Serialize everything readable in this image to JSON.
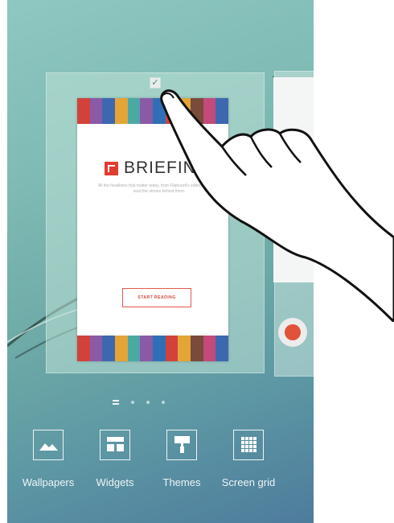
{
  "widget": {
    "brand": "BRIEFING",
    "description": "All the headlines that matter today, from Flipboard's editors. Swipe to read the stories behind them.",
    "button_label": "START READING",
    "stripe_colors": [
      "#d2423b",
      "#8a5aa6",
      "#3d68b0",
      "#e4a436",
      "#4aa9a5",
      "#8a5aa6",
      "#2f6fb7",
      "#d2423b",
      "#e4a436",
      "#7a4a3a",
      "#c34a7a",
      "#3d68b0"
    ]
  },
  "page_indicator": {
    "pages": 4,
    "current": 1
  },
  "options": [
    {
      "label": "Wallpapers",
      "icon": "wallpapers-icon"
    },
    {
      "label": "Widgets",
      "icon": "widgets-icon"
    },
    {
      "label": "Themes",
      "icon": "themes-icon"
    },
    {
      "label": "Screen grid",
      "icon": "screen-grid-icon"
    }
  ],
  "colors": {
    "accent": "#e23b2f",
    "wallpaper_top": "#8fc7c2",
    "wallpaper_bottom": "#4d7c9c"
  }
}
